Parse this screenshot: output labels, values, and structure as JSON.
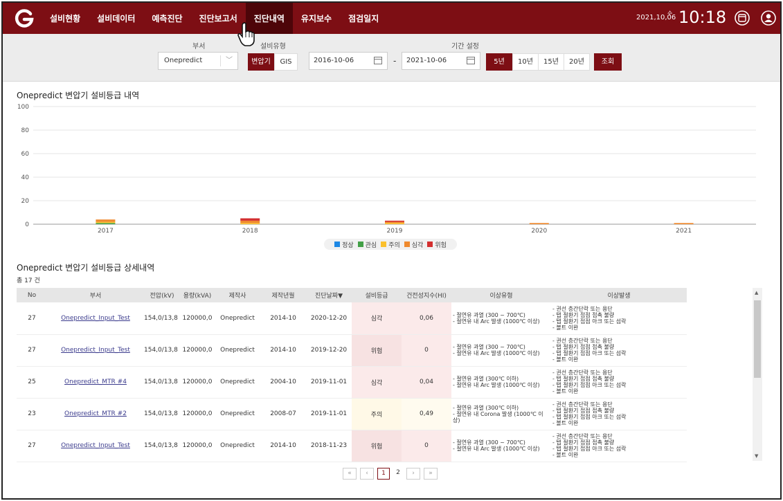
{
  "header": {
    "nav": [
      "설비현황",
      "설비데이터",
      "예측진단",
      "진단보고서",
      "진단내역",
      "유지보수",
      "점검일지"
    ],
    "active_nav": "진단내역",
    "date": "2021,10,06",
    "day": "수",
    "time": "10:18",
    "icons": [
      "report-icon",
      "user-icon"
    ]
  },
  "filters": {
    "dept_label": "부서",
    "dept_value": "Onepredict",
    "type_label": "설비유형",
    "type_options": [
      "변압기",
      "GIS"
    ],
    "period_label": "기간 설정",
    "date_from": "2016-10-06",
    "date_to": "2021-10-06",
    "period_options": [
      "5년",
      "10년",
      "15년",
      "20년"
    ],
    "search_label": "조회"
  },
  "chart_data": {
    "type": "bar",
    "title": "Onepredict 변압기 설비등급 내역",
    "categories": [
      "2017",
      "2018",
      "2019",
      "2020",
      "2021"
    ],
    "ylim": [
      0,
      100
    ],
    "yticks": [
      "100",
      "80",
      "60",
      "40",
      "20",
      "0"
    ],
    "stacked": true,
    "series": [
      {
        "name": "정상",
        "color": "#1e88e5",
        "values": [
          0,
          0,
          0,
          0,
          0
        ]
      },
      {
        "name": "관심",
        "color": "#43a047",
        "values": [
          1,
          0,
          0,
          0,
          0
        ]
      },
      {
        "name": "주의",
        "color": "#fbc02d",
        "values": [
          1,
          1,
          1,
          0,
          0
        ]
      },
      {
        "name": "심각",
        "color": "#ef8a2f",
        "values": [
          2,
          2,
          1,
          1,
          1
        ]
      },
      {
        "name": "위험",
        "color": "#d32f2f",
        "values": [
          0,
          2,
          1,
          0,
          0
        ]
      }
    ]
  },
  "table": {
    "title": "Onepredict 변압기 설비등급 상세내역",
    "count": "총 17 건",
    "columns": [
      "No",
      "부서",
      "전압(kV)",
      "용량(kVA)",
      "제작사",
      "제작년월",
      "진단날짜▼",
      "설비등급",
      "건전성지수(HI)",
      "이상유형",
      "이상발생"
    ],
    "rows": [
      {
        "no": "27",
        "dept": "Onepredict_Input_Test",
        "volt": "154,0/13,8",
        "cap": "120000,0",
        "maker": "Onepredict",
        "made": "2014-10",
        "date": "2020-12-20",
        "grade": "심각",
        "grade_class": "simgak",
        "hi": "0,06",
        "type": "- 절연유 과열 (300 ~ 700℃)\n- 절연유 내 Arc 발생 (1000℃ 이상)",
        "cause": "- 권선 층간단락 또는 용단\n- 탭 절환기 접점 접촉 불량\n- 탭 절환기 접점 아크 또는 섬락\n- 볼트 이완"
      },
      {
        "no": "27",
        "dept": "Onepredict_Input_Test",
        "volt": "154,0/13,8",
        "cap": "120000,0",
        "maker": "Onepredict",
        "made": "2014-10",
        "date": "2019-12-20",
        "grade": "위험",
        "grade_class": "wiheom",
        "hi": "0",
        "type": "- 절연유 과열 (300 ~ 700℃)\n- 절연유 내 Arc 발생 (1000℃ 이상)",
        "cause": "- 권선 층간단락 또는 용단\n- 탭 절환기 접점 접촉 불량\n- 탭 절환기 접점 아크 또는 섬락\n- 볼트 이완"
      },
      {
        "no": "25",
        "dept": "Onepredict_MTR #4",
        "volt": "154,0/13,8",
        "cap": "120000,0",
        "maker": "Onepredict",
        "made": "2004-10",
        "date": "2019-11-01",
        "grade": "심각",
        "grade_class": "simgak",
        "hi": "0,04",
        "type": "- 절연유 과열 (300℃ 이하)\n- 절연유 내 Arc 발생 (1000℃ 이상)",
        "cause": "- 권선 층간단락 또는 용단\n- 탭 절환기 접점 접촉 불량\n- 탭 절환기 접점 아크 또는 섬락\n- 볼트 이완"
      },
      {
        "no": "23",
        "dept": "Onepredict_MTR #2",
        "volt": "154,0/13,8",
        "cap": "120000,0",
        "maker": "Onepredict",
        "made": "2008-07",
        "date": "2019-11-01",
        "grade": "주의",
        "grade_class": "juui",
        "hi": "0,49",
        "type": "- 절연유 과열 (300℃ 이하)\n- 절연유 내 Corona 발생 (1000℃ 이\n상)",
        "cause": "- 권선 층간단락 또는 용단\n- 탭 절환기 접점 접촉 불량\n- 탭 절환기 접점 아크 또는 섬락\n- 볼트 이완"
      },
      {
        "no": "27",
        "dept": "Onepredict_Input_Test",
        "volt": "154,0/13,8",
        "cap": "120000,0",
        "maker": "Onepredict",
        "made": "2014-10",
        "date": "2018-11-23",
        "grade": "위험",
        "grade_class": "wiheom",
        "hi": "0",
        "type": "- 절연유 과열 (300 ~ 700℃)\n- 절연유 내 Arc 발생 (1000℃ 이상)",
        "cause": "- 권선 층간단락 또는 용단\n- 탭 절환기 접점 접촉 불량\n- 탭 절환기 접점 아크 또는 섬락\n- 볼트 이완"
      }
    ]
  },
  "pagination": {
    "first": "«",
    "prev": "‹",
    "pages": [
      "1",
      "2"
    ],
    "current": "1",
    "next": "›",
    "last": "»"
  }
}
